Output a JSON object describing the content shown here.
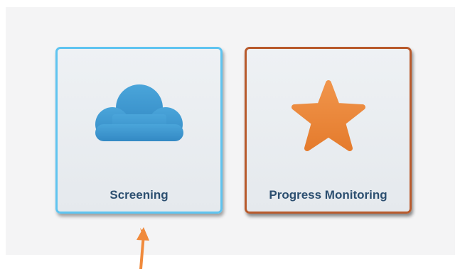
{
  "tiles": {
    "screening": {
      "label": "Screening",
      "icon": "cloud-icon",
      "border_color": "#5fc4f0",
      "icon_color": "#3a97cf"
    },
    "progress_monitoring": {
      "label": "Progress Monitoring",
      "icon": "star-icon",
      "border_color": "#b85a2c",
      "icon_color": "#ea8a3c"
    }
  },
  "annotation": {
    "icon": "arrow-up-icon",
    "color": "#f08a3c"
  }
}
